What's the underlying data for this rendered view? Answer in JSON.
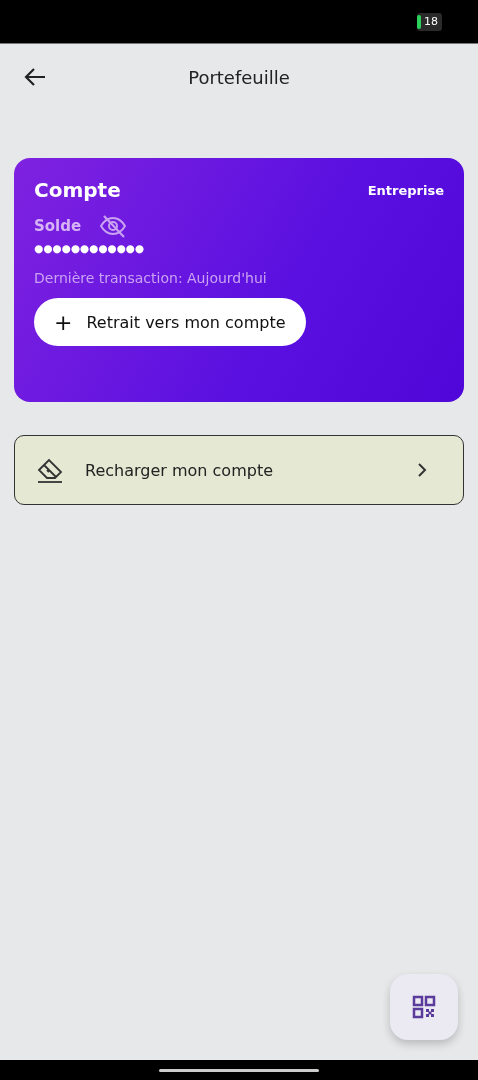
{
  "status_bar": {
    "battery": "18"
  },
  "app_bar": {
    "title": "Portefeuille"
  },
  "account_card": {
    "title": "Compte",
    "type": "Entreprise",
    "balance_label": "Solde",
    "balance_hidden": true,
    "balance": "●●●●●●●●●●●●",
    "last_transaction": "Dernière transaction: Aujourd'hui",
    "withdraw_button": {
      "icon": "+",
      "label": "Retrait vers mon compte"
    }
  },
  "menu_items": [
    {
      "label": "Recharger mon compte"
    }
  ]
}
